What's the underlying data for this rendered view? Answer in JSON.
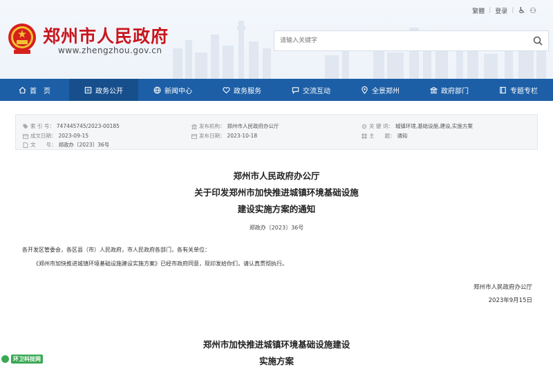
{
  "top_links": {
    "traditional": "繁體",
    "login": "登录"
  },
  "site": {
    "title": "郑州市人民政府",
    "url": "www.zhengzhou.gov.cn"
  },
  "search": {
    "placeholder": "请输入关键字"
  },
  "nav": {
    "items": [
      {
        "label": "首　页",
        "icon": "home-icon"
      },
      {
        "label": "政务公开",
        "icon": "document-icon"
      },
      {
        "label": "新闻中心",
        "icon": "globe-icon"
      },
      {
        "label": "政务服务",
        "icon": "heart-icon"
      },
      {
        "label": "交流互动",
        "icon": "chat-icon"
      },
      {
        "label": "全景郑州",
        "icon": "location-icon"
      },
      {
        "label": "政府部门",
        "icon": "building-icon"
      },
      {
        "label": "专题专栏",
        "icon": "book-icon"
      }
    ],
    "active_index": 1
  },
  "meta": {
    "index_key": "索 引 号：",
    "index_val": "747445745/2023-00185",
    "publisher_key": "发布机构：",
    "publisher_val": "郑州市人民政府办公厅",
    "keywords_key": "关 键 词：",
    "keywords_val": "城镇环境,基础设施,建设,实施方案",
    "created_key": "成文日期：",
    "created_val": "2023-09-15",
    "published_key": "发布日期：",
    "published_val": "2023-10-18",
    "subject_key": "主　　题：",
    "subject_val": "通知",
    "docno_key": "文　　号：",
    "docno_val": "郑政办〔2023〕36号"
  },
  "document": {
    "issuer": "郑州市人民政府办公厅",
    "title_line1": "关于印发郑州市加快推进城镇环境基础设施",
    "title_line2": "建设实施方案的通知",
    "doc_number": "郑政办〔2023〕36号",
    "addressees": "各开发区管委会，各区县（市）人民政府，市人民政府各部门，各有关单位：",
    "body": "《郑州市加快推进城镇环境基础设施建设实施方案》已经市政府同意，现印发给你们，请认真贯彻执行。",
    "sign_org": "郑州市人民政府办公厅",
    "sign_date": "2023年9月15日",
    "attachment_title_line1": "郑州市加快推进城镇环境基础设施建设",
    "attachment_title_line2": "实施方案"
  },
  "watermark": {
    "text": "环卫科技网"
  },
  "colors": {
    "brand_red": "#c8161d",
    "nav_blue": "#1d5fa6",
    "nav_active": "#174f8d"
  }
}
